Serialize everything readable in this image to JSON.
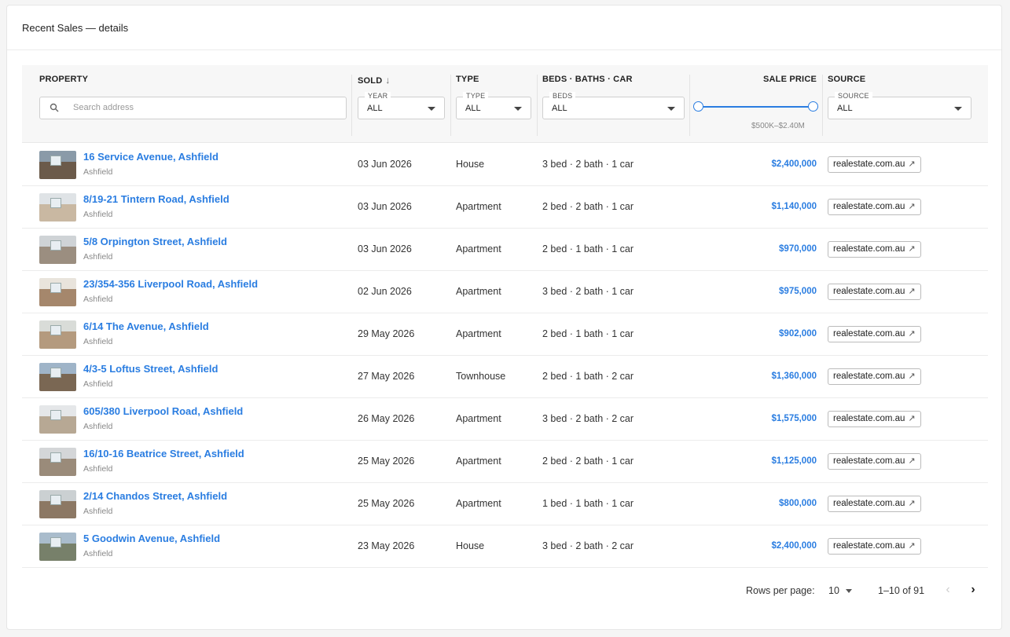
{
  "card": {
    "title": "Recent Sales — details"
  },
  "columns": {
    "property": "PROPERTY",
    "sold": "SOLD",
    "type": "TYPE",
    "beds": "BEDS · BATHS · CAR",
    "price": "SALE PRICE",
    "source": "SOURCE"
  },
  "filters": {
    "search_placeholder": "Search address",
    "year": {
      "label": "YEAR",
      "value": "ALL"
    },
    "type": {
      "label": "TYPE",
      "value": "ALL"
    },
    "beds": {
      "label": "BEDS",
      "value": "ALL"
    },
    "source": {
      "label": "SOURCE",
      "value": "ALL"
    },
    "price_range_text": "$500K–$2.40M"
  },
  "rows": [
    {
      "address": "16 Service Avenue, Ashfield",
      "suburb": "Ashfield",
      "sold": "03 Jun 2026",
      "type": "House",
      "rooms": "3 bed · 2 bath · 1 car",
      "price": "$2,400,000",
      "source": "realestate.com.au"
    },
    {
      "address": "8/19-21 Tintern Road, Ashfield",
      "suburb": "Ashfield",
      "sold": "03 Jun 2026",
      "type": "Apartment",
      "rooms": "2 bed · 2 bath · 1 car",
      "price": "$1,140,000",
      "source": "realestate.com.au"
    },
    {
      "address": "5/8 Orpington Street, Ashfield",
      "suburb": "Ashfield",
      "sold": "03 Jun 2026",
      "type": "Apartment",
      "rooms": "2 bed · 1 bath · 1 car",
      "price": "$970,000",
      "source": "realestate.com.au"
    },
    {
      "address": "23/354-356 Liverpool Road, Ashfield",
      "suburb": "Ashfield",
      "sold": "02 Jun 2026",
      "type": "Apartment",
      "rooms": "3 bed · 2 bath · 1 car",
      "price": "$975,000",
      "source": "realestate.com.au"
    },
    {
      "address": "6/14 The Avenue, Ashfield",
      "suburb": "Ashfield",
      "sold": "29 May 2026",
      "type": "Apartment",
      "rooms": "2 bed · 1 bath · 1 car",
      "price": "$902,000",
      "source": "realestate.com.au"
    },
    {
      "address": "4/3-5 Loftus Street, Ashfield",
      "suburb": "Ashfield",
      "sold": "27 May 2026",
      "type": "Townhouse",
      "rooms": "2 bed · 1 bath · 2 car",
      "price": "$1,360,000",
      "source": "realestate.com.au"
    },
    {
      "address": "605/380 Liverpool Road, Ashfield",
      "suburb": "Ashfield",
      "sold": "26 May 2026",
      "type": "Apartment",
      "rooms": "3 bed · 2 bath · 2 car",
      "price": "$1,575,000",
      "source": "realestate.com.au"
    },
    {
      "address": "16/10-16 Beatrice Street, Ashfield",
      "suburb": "Ashfield",
      "sold": "25 May 2026",
      "type": "Apartment",
      "rooms": "2 bed · 2 bath · 1 car",
      "price": "$1,125,000",
      "source": "realestate.com.au"
    },
    {
      "address": "2/14 Chandos Street, Ashfield",
      "suburb": "Ashfield",
      "sold": "25 May 2026",
      "type": "Apartment",
      "rooms": "1 bed · 1 bath · 1 car",
      "price": "$800,000",
      "source": "realestate.com.au"
    },
    {
      "address": "5 Goodwin Avenue, Ashfield",
      "suburb": "Ashfield",
      "sold": "23 May 2026",
      "type": "House",
      "rooms": "3 bed · 2 bath · 2 car",
      "price": "$2,400,000",
      "source": "realestate.com.au"
    }
  ],
  "pagination": {
    "rows_label": "Rows per page:",
    "rows_value": "10",
    "range": "1–10 of 91"
  },
  "colors": {
    "accent": "#2a7de1"
  }
}
